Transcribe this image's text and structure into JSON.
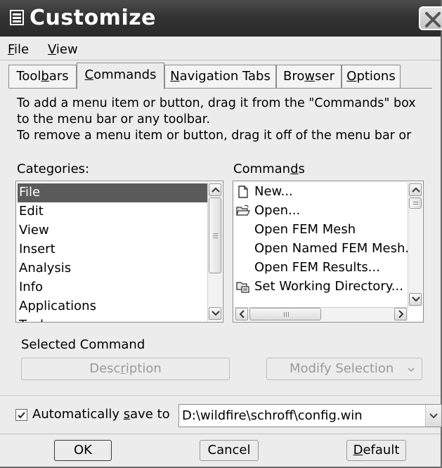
{
  "window": {
    "title": "Customize"
  },
  "menu": [
    {
      "label": "File",
      "mnemonic": "F",
      "rest": "ile"
    },
    {
      "label": "View",
      "mnemonic": "V",
      "rest": "iew"
    }
  ],
  "tabs": [
    {
      "label": "Toolbars",
      "pre": "Tool",
      "mnemonic": "b",
      "post": "ars",
      "active": false
    },
    {
      "label": "Commands",
      "pre": "",
      "mnemonic": "C",
      "post": "ommands",
      "active": true
    },
    {
      "label": "Navigation Tabs",
      "pre": "",
      "mnemonic": "N",
      "post": "avigation Tabs",
      "active": false
    },
    {
      "label": "Browser",
      "pre": "Bro",
      "mnemonic": "w",
      "post": "ser",
      "active": false
    },
    {
      "label": "Options",
      "pre": "",
      "mnemonic": "O",
      "post": "ptions",
      "active": false
    }
  ],
  "instructions": [
    "To add a menu item or button, drag it from the \"Commands\" box",
    "to the menu bar or any toolbar.",
    "To remove a menu item or button, drag it off of the menu bar or"
  ],
  "categories": {
    "label": "Categories:",
    "items": [
      "File",
      "Edit",
      "View",
      "Insert",
      "Analysis",
      "Info",
      "Applications",
      "Tools"
    ],
    "selected": "File"
  },
  "commands": {
    "label_pre": "Comman",
    "label_mnemonic": "d",
    "label_post": "s",
    "items": [
      {
        "label": "New...",
        "icon": "new-document-icon"
      },
      {
        "label": "Open...",
        "icon": "open-folder-icon"
      },
      {
        "label": "Open FEM Mesh",
        "icon": ""
      },
      {
        "label": "Open Named FEM Mesh...",
        "icon": ""
      },
      {
        "label": "Open FEM Results...",
        "icon": ""
      },
      {
        "label": "Set Working Directory...",
        "icon": "working-directory-icon"
      }
    ]
  },
  "selected_command": {
    "label": "Selected Command",
    "description_pre": "Desc",
    "description_mnemonic": "r",
    "description_post": "iption",
    "modify_label": "Modify Selection"
  },
  "autosave": {
    "checked": true,
    "label_pre": "Automatically ",
    "label_mnemonic": "s",
    "label_post": "ave to",
    "path": "D:\\wildfire\\schroff\\config.win"
  },
  "buttons": {
    "ok": "OK",
    "cancel": "Cancel",
    "default_pre": "",
    "default_mnemonic": "D",
    "default_post": "efault"
  },
  "colors": {
    "titlebar": "#333333",
    "selection": "#5a5a5a",
    "window_bg": "#ececec"
  }
}
